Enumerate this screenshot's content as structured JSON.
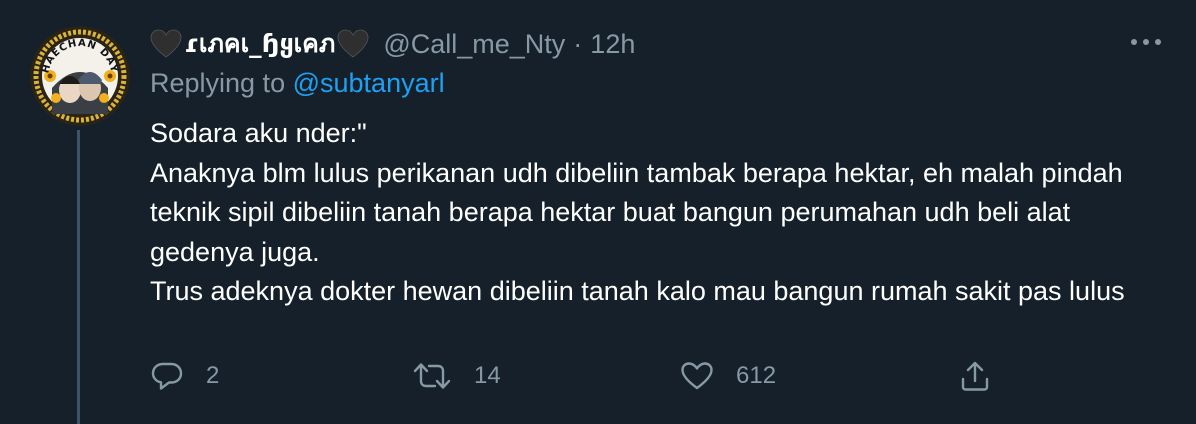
{
  "tweet": {
    "display_name": "ɾเภคเ_ɧყเคภ",
    "handle": "@Call_me_Nty",
    "separator": "·",
    "time": "12h",
    "replying_prefix": "Replying to",
    "replying_to": "@subtanyarl",
    "body": "Sodara aku nder:\"\nAnaknya blm lulus perikanan udh dibeliin tambak berapa hektar, eh malah pindah teknik sipil dibeliin tanah berapa hektar buat bangun perumahan udh beli alat gedenya juga.\nTrus adeknya dokter hewan dibeliin tanah kalo mau bangun rumah sakit pas lulus",
    "avatar_text": "HAECHAN DAY"
  },
  "actions": {
    "reply_count": "2",
    "retweet_count": "14",
    "like_count": "612"
  },
  "icons": {
    "name_heart_left": "black-heart-icon",
    "name_heart_right": "black-heart-icon",
    "more": "more-dots-icon",
    "reply": "reply-icon",
    "retweet": "retweet-icon",
    "like": "like-heart-icon",
    "share": "share-icon"
  },
  "colors": {
    "background": "#15202b",
    "secondary_text": "#8899a6",
    "link": "#1da1f2",
    "thread_line": "#3d5466"
  }
}
